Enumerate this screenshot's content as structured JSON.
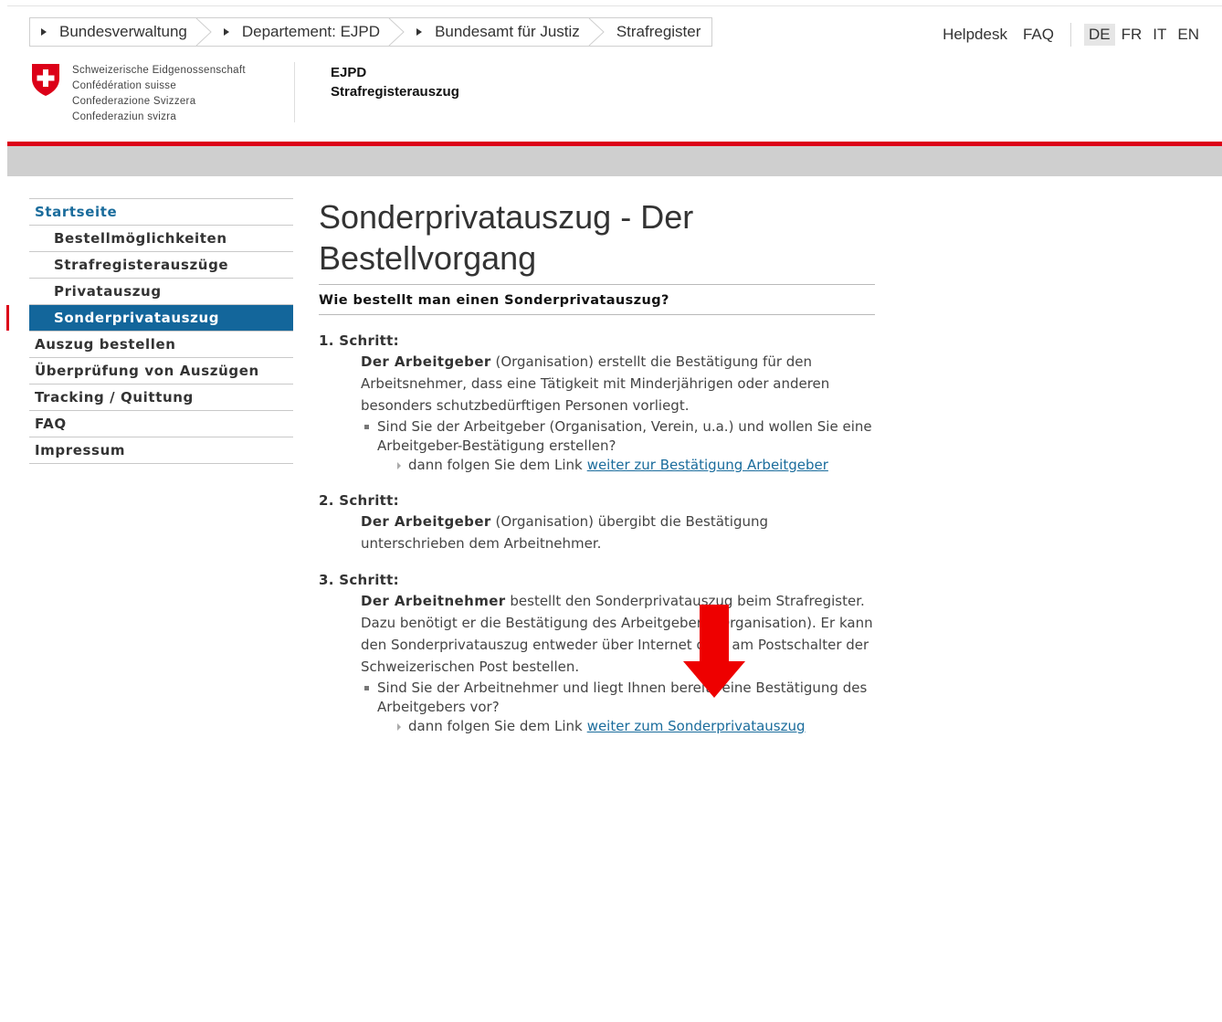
{
  "breadcrumb": [
    {
      "label": "Bundesverwaltung"
    },
    {
      "label": "Departement: EJPD"
    },
    {
      "label": "Bundesamt für Justiz"
    },
    {
      "label": "Strafregister"
    }
  ],
  "meta_nav": {
    "helpdesk": "Helpdesk",
    "faq": "FAQ",
    "languages": [
      "DE",
      "FR",
      "IT",
      "EN"
    ],
    "active_language": "DE"
  },
  "logo": {
    "lines": [
      "Schweizerische Eidgenossenschaft",
      "Confédération suisse",
      "Confederazione Svizzera",
      "Confederaziun svizra"
    ]
  },
  "department": {
    "name": "EJPD",
    "service": "Strafregisterauszug"
  },
  "colors": {
    "accent_red": "#dc0018",
    "nav_active": "#13669b",
    "link": "#1a6c9c"
  },
  "sidenav": {
    "items": [
      {
        "label": "Startseite"
      },
      {
        "label": "Bestellmöglichkeiten"
      },
      {
        "label": "Strafregisterauszüge"
      },
      {
        "label": "Privatauszug"
      },
      {
        "label": "Sonderprivatauszug"
      },
      {
        "label": "Auszug bestellen"
      },
      {
        "label": "Überprüfung von Auszügen"
      },
      {
        "label": "Tracking / Quittung"
      },
      {
        "label": "FAQ"
      },
      {
        "label": "Impressum"
      }
    ]
  },
  "main": {
    "title": "Sonderprivatauszug - Der Bestellvorgang",
    "subtitle": "Wie bestellt man einen Sonderprivatauszug?",
    "steps": [
      {
        "title": "1. Schritt:",
        "actor": "Der Arbeitgeber",
        "text": " (Organisation) erstellt die Bestätigung für den Arbeitsnehmer, dass eine Tätigkeit mit Minderjährigen oder anderen besonders schutzbedürftigen Personen vorliegt.",
        "bullet": "Sind Sie der Arbeitgeber (Organisation, Verein, u.a.) und wollen Sie eine Arbeitgeber-Bestätigung erstellen?",
        "link_prefix": "dann folgen Sie dem Link",
        "link_label": "weiter zur Bestätigung Arbeitgeber"
      },
      {
        "title": "2. Schritt:",
        "actor": "Der Arbeitgeber",
        "text": " (Organisation) übergibt die Bestätigung unterschrieben dem Arbeitnehmer."
      },
      {
        "title": "3. Schritt:",
        "actor": "Der Arbeitnehmer",
        "text": " bestellt den Sonderprivatauszug beim Strafregister. Dazu benötigt er die Bestätigung des Arbeitgebers (Organisation). Er kann den Sonderprivatauszug entweder über Internet oder am Postschalter der Schweizerischen Post bestellen.",
        "bullet": "Sind Sie der Arbeitnehmer und liegt Ihnen bereits eine Bestätigung des Arbeitgebers vor?",
        "link_prefix": "dann folgen Sie dem Link",
        "link_label": "weiter zum Sonderprivatauszug"
      }
    ]
  }
}
